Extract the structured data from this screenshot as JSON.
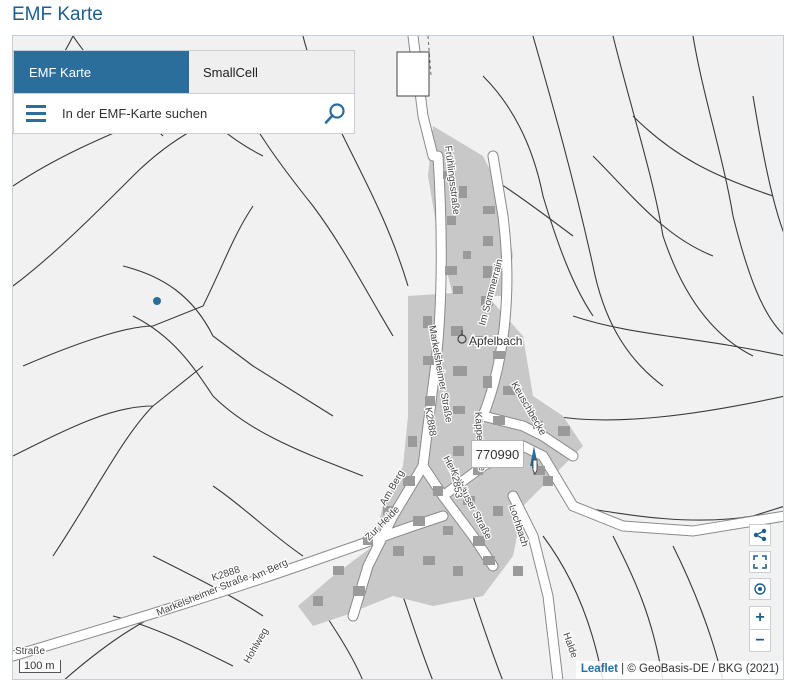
{
  "page": {
    "title": "EMF Karte"
  },
  "tabs": [
    {
      "label": "EMF Karte",
      "active": true
    },
    {
      "label": "SmallCell",
      "active": false
    }
  ],
  "search": {
    "placeholder": "In der EMF-Karte suchen",
    "value": ""
  },
  "map": {
    "place_label": "Apfelbach",
    "street_labels": [
      "Frühlingsstraße",
      "Im Sommerrain",
      "Markelsheimer Straße",
      "Herbsthäuser Straße",
      "Am Berg",
      "Am Berg",
      "Markelsheimer Straße",
      "Keuschbecke",
      "Käppelstraße",
      "Lochbach",
      "Zur Heide",
      "Hohlweg",
      "K2888",
      "K2888",
      "K2853",
      "Straße",
      "Halde",
      "K2853"
    ],
    "site_label": "770990",
    "scale": "100 m",
    "attribution_link": "Leaflet",
    "attribution_text": " | © GeoBasis-DE / BKG (2021)",
    "colors": {
      "accent": "#2b6e9b",
      "background": "#f1f1f1",
      "buildings": "#9a9a9a",
      "builtup": "#c8c8c8"
    }
  },
  "controls": {
    "share_icon": "share-icon",
    "fullscreen_icon": "fullscreen-icon",
    "locate_icon": "locate-icon",
    "zoom_in": "+",
    "zoom_out": "−"
  }
}
